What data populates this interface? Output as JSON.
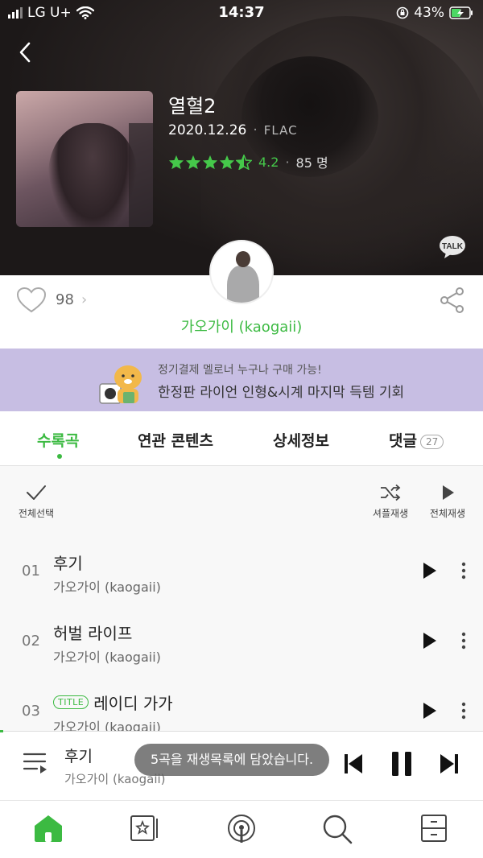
{
  "status_bar": {
    "carrier": "LG U+",
    "time": "14:37",
    "battery": "43%"
  },
  "album": {
    "title": "열혈2",
    "date": "2020.12.26",
    "format": "FLAC",
    "rating": "4.2",
    "rating_count": "85 명",
    "stars": 4.5
  },
  "likes": {
    "count": "98"
  },
  "artist": {
    "name": "가오가이 (kaogaii)"
  },
  "banner": {
    "line1": "정기결제 멜로너 누구나 구매 가능!",
    "line2": "한정판 라이언 인형&시계 마지막 득템 기회"
  },
  "tabs": [
    {
      "label": "수록곡"
    },
    {
      "label": "연관 콘텐츠"
    },
    {
      "label": "상세정보"
    },
    {
      "label": "댓글",
      "badge": "27"
    }
  ],
  "toolbar": {
    "select_all": "전체선택",
    "shuffle": "셔플재생",
    "play_all": "전체재생"
  },
  "tracks": [
    {
      "no": "01",
      "title": "후기",
      "artist": "가오가이 (kaogaii)",
      "title_tag": ""
    },
    {
      "no": "02",
      "title": "허벌 라이프",
      "artist": "가오가이 (kaogaii)",
      "title_tag": ""
    },
    {
      "no": "03",
      "title": "레이디 가가",
      "artist": "가오가이 (kaogaii)",
      "title_tag": "TITLE"
    }
  ],
  "player": {
    "title": "후기",
    "artist": "가오가이 (kaogaii)",
    "toast": "5곡을 재생목록에 담았습니다."
  },
  "icons": {
    "talk": "TALK",
    "accent": "#3cba42"
  }
}
